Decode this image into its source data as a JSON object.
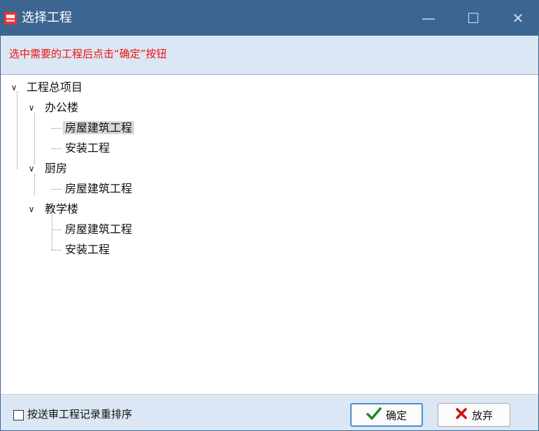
{
  "window": {
    "title": "选择工程",
    "icon": "app-logo-icon"
  },
  "titlebar_buttons": {
    "minimize": "—",
    "maximize": "☐",
    "close": "✕"
  },
  "instruction": "选中需要的工程后点击“确定”按钮",
  "tree": {
    "root": "工程总项目",
    "groups": [
      {
        "label": "办公楼",
        "children": [
          "房屋建筑工程",
          "安装工程"
        ]
      },
      {
        "label": "厨房",
        "children": [
          "房屋建筑工程"
        ]
      },
      {
        "label": "教学楼",
        "children": [
          "房屋建筑工程",
          "安装工程"
        ]
      }
    ],
    "selected": "办公楼 / 房屋建筑工程"
  },
  "footer": {
    "checkbox_label": "按送审工程记录重排序",
    "checkbox_checked": false,
    "ok_label": "确定",
    "cancel_label": "放弃"
  },
  "colors": {
    "titlebar": "#3d6591",
    "panel": "#dbe7f4",
    "instruction_text": "#ee1111",
    "ok_icon": "#1c8a1c",
    "cancel_icon": "#cc1111"
  }
}
